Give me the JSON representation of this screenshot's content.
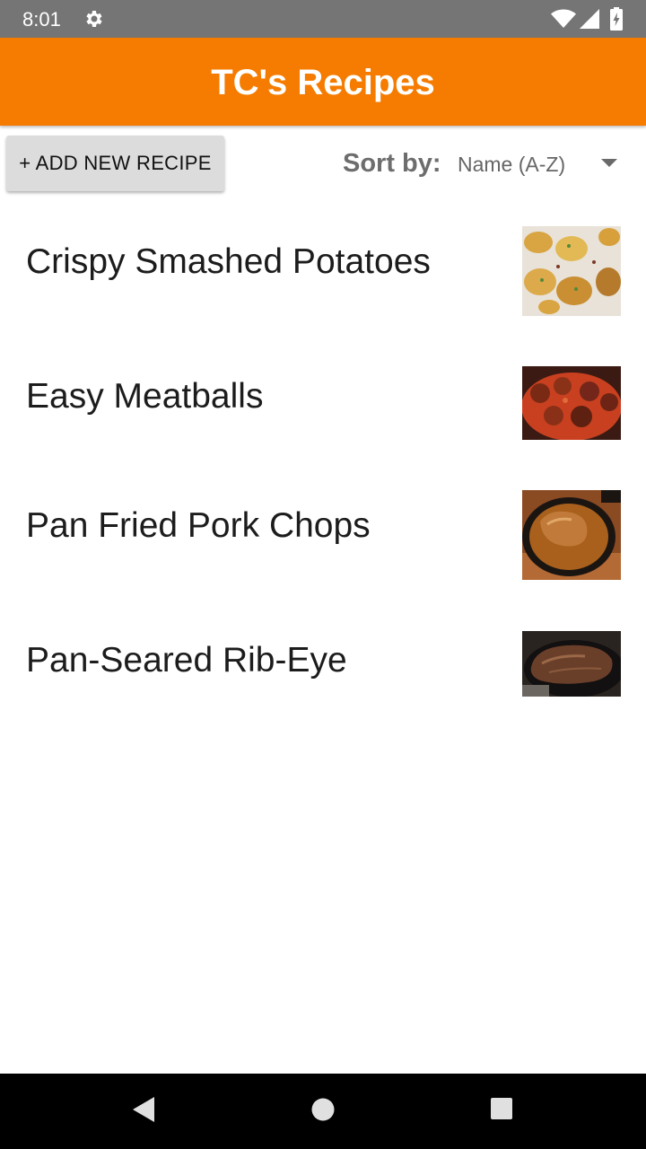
{
  "status_bar": {
    "time": "8:01",
    "icons": [
      "gear-icon",
      "wifi-icon",
      "signal-icon",
      "battery-charging-icon"
    ]
  },
  "app_bar": {
    "title": "TC's Recipes",
    "color": "#f57c00"
  },
  "toolbar": {
    "add_label": "+ ADD NEW RECIPE",
    "sort_label": "Sort by:",
    "sort_value": "Name (A-Z)"
  },
  "recipes": [
    {
      "name": "Crispy Smashed Potatoes"
    },
    {
      "name": "Easy Meatballs"
    },
    {
      "name": "Pan Fried Pork Chops"
    },
    {
      "name": "Pan-Seared Rib-Eye"
    }
  ],
  "nav_bar": {
    "icons": [
      "back-icon",
      "home-icon",
      "recents-icon"
    ]
  }
}
